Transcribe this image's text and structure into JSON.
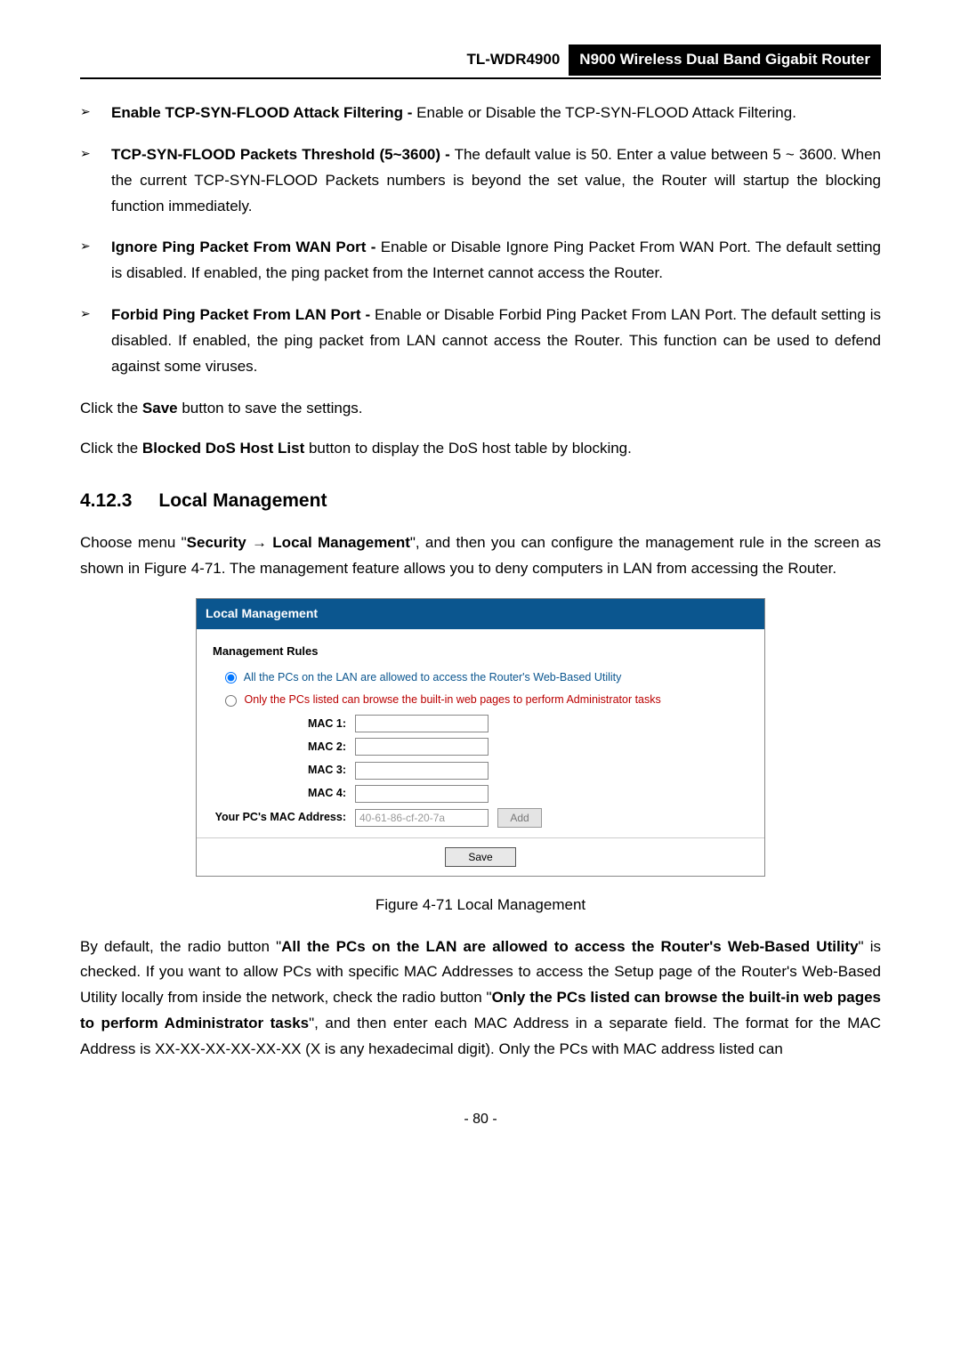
{
  "header": {
    "model": "TL-WDR4900",
    "desc": "N900 Wireless Dual Band Gigabit Router"
  },
  "bullets": [
    {
      "title": "Enable TCP-SYN-FLOOD Attack Filtering -",
      "body": " Enable or Disable the TCP-SYN-FLOOD Attack Filtering."
    },
    {
      "title": "TCP-SYN-FLOOD Packets Threshold (5~3600) -",
      "body": " The default value is 50. Enter a value between 5 ~ 3600. When the current TCP-SYN-FLOOD Packets numbers is beyond the set value, the Router will startup the blocking function immediately."
    },
    {
      "title": "Ignore Ping Packet From WAN Port -",
      "body": " Enable or Disable Ignore Ping Packet From WAN Port. The default setting is disabled. If enabled, the ping packet from the Internet cannot access the Router."
    },
    {
      "title": "Forbid Ping Packet From LAN Port -",
      "body": " Enable or Disable Forbid Ping Packet From LAN Port. The default setting is disabled. If enabled, the ping packet from LAN cannot access the Router. This function can be used to defend against some viruses."
    }
  ],
  "p_save_pre": "Click the ",
  "p_save_b": "Save",
  "p_save_post": " button to save the settings.",
  "p_block_pre": "Click the ",
  "p_block_b": "Blocked DoS Host List",
  "p_block_post": " button to display the DoS host table by blocking.",
  "section": {
    "num": "4.12.3",
    "title": "Local Management"
  },
  "intro": {
    "pre": "Choose menu \"",
    "menu1": "Security",
    "arrow": " → ",
    "menu2": "Local Management",
    "post": "\", and then you can configure the management rule in the screen as shown in Figure 4-71. The management feature allows you to deny computers in LAN from accessing the Router."
  },
  "panel": {
    "title": "Local Management",
    "rules_heading": "Management Rules",
    "radio_all": "All the PCs on the LAN are allowed to access the Router's Web-Based Utility",
    "radio_only": "Only the PCs listed can browse the built-in web pages to perform Administrator tasks",
    "mac1": "MAC 1:",
    "mac2": "MAC 2:",
    "mac3": "MAC 3:",
    "mac4": "MAC 4:",
    "your_mac_lbl": "Your PC's MAC Address:",
    "your_mac_val": "40-61-86-cf-20-7a",
    "add": "Add",
    "save": "Save"
  },
  "fig_caption": "Figure 4-71 Local Management",
  "final": {
    "pre": "By default, the radio button \"",
    "b1": "All the PCs on the LAN are allowed to access the Router's Web-Based Utility",
    "mid1": "\" is checked. If you want to allow PCs with specific MAC Addresses to access the Setup page of the Router's Web-Based Utility locally from inside the network, check the radio button \"",
    "b2": "Only the PCs listed can browse the built-in web pages to perform Administrator tasks",
    "mid2": "\", and then enter each MAC Address in a separate field. The format for the MAC Address is XX-XX-XX-XX-XX-XX (X is any hexadecimal digit). Only the PCs with MAC address listed can"
  },
  "page_num": "- 80 -"
}
